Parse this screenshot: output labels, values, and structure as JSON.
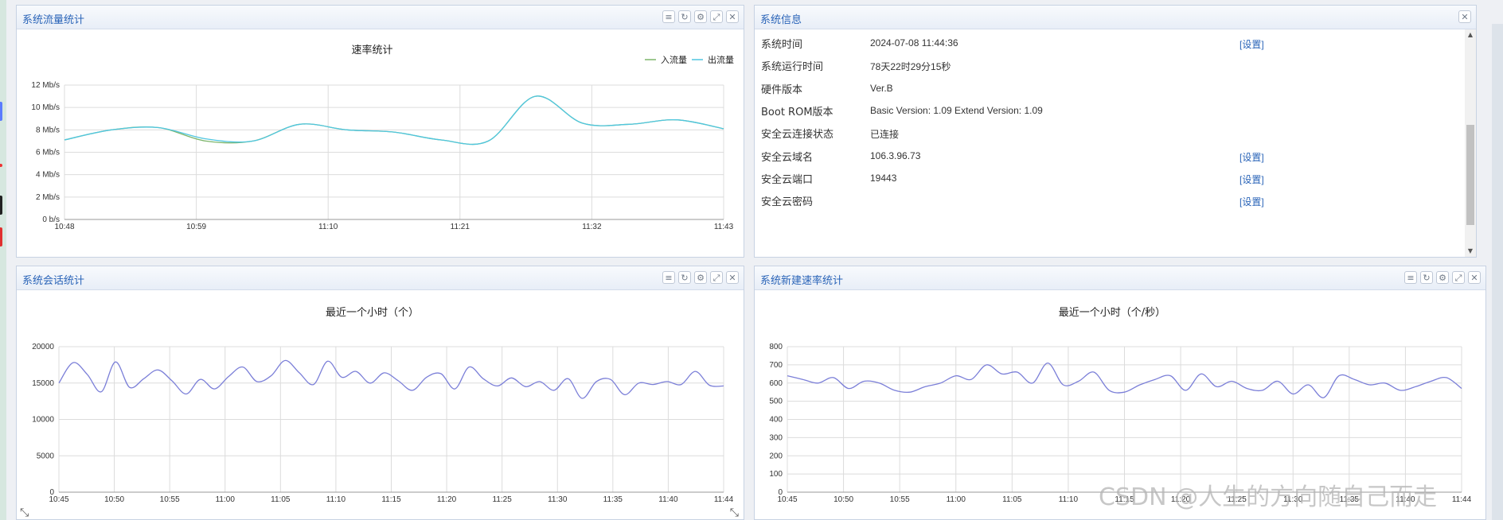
{
  "panels": {
    "traffic": {
      "title": "系统流量统计",
      "icons": [
        "list-icon",
        "refresh-icon",
        "gear-icon",
        "expand-icon",
        "close-icon"
      ]
    },
    "sysinfo": {
      "title": "系统信息",
      "icons": [
        "close-icon"
      ],
      "rows": [
        {
          "label": "系统时间",
          "value": "2024-07-08 11:44:36",
          "link": "[设置]"
        },
        {
          "label": "系统运行时间",
          "value": "78天22时29分15秒",
          "link": ""
        },
        {
          "label": "硬件版本",
          "value": "Ver.B",
          "link": ""
        },
        {
          "label": "Boot ROM版本",
          "value": "Basic Version:  1.09   Extend Version:  1.09",
          "link": ""
        },
        {
          "label": "安全云连接状态",
          "value": "已连接",
          "link": ""
        },
        {
          "label": "安全云域名",
          "value": "106.3.96.73",
          "link": "[设置]"
        },
        {
          "label": "安全云端口",
          "value": "19443",
          "link": "[设置]"
        },
        {
          "label": "安全云密码",
          "value": "",
          "link": "[设置]"
        }
      ]
    },
    "sessions": {
      "title": "系统会话统计",
      "icons": [
        "list-icon",
        "refresh-icon",
        "gear-icon",
        "expand-icon",
        "close-icon"
      ]
    },
    "newrate": {
      "title": "系统新建速率统计",
      "icons": [
        "list-icon",
        "refresh-icon",
        "gear-icon",
        "expand-icon",
        "close-icon"
      ]
    }
  },
  "watermark": "CSDN @人生的方向随自己而走",
  "chart_data": [
    {
      "type": "line",
      "title": "速率统计",
      "x": [
        "10:48",
        "10:59",
        "11:10",
        "11:21",
        "11:32",
        "11:43"
      ],
      "y_ticks": [
        "0 b/s",
        "2 Mb/s",
        "4 Mb/s",
        "6 Mb/s",
        "8 Mb/s",
        "10 Mb/s",
        "12 Mb/s"
      ],
      "ylim": [
        0,
        12
      ],
      "legend_position": "top-right",
      "series": [
        {
          "name": "入流量",
          "color": "#7cb56b",
          "values": [
            7.1,
            8.0,
            8.2,
            7.0,
            7.0,
            8.5,
            8.0,
            7.8,
            7.1,
            7.0,
            11.0,
            8.6,
            8.5,
            8.9,
            8.1
          ]
        },
        {
          "name": "出流量",
          "color": "#4fc6e0",
          "values": [
            7.1,
            8.0,
            8.2,
            7.2,
            7.0,
            8.5,
            8.0,
            7.8,
            7.1,
            7.0,
            11.0,
            8.6,
            8.5,
            8.9,
            8.1
          ]
        }
      ]
    },
    {
      "type": "line",
      "title": "最近一个小时（个）",
      "x": [
        "10:45",
        "10:50",
        "10:55",
        "11:00",
        "11:05",
        "11:10",
        "11:15",
        "11:20",
        "11:25",
        "11:30",
        "11:35",
        "11:40",
        "11:44"
      ],
      "y_ticks": [
        "0",
        "5000",
        "10000",
        "15000",
        "20000"
      ],
      "ylim": [
        0,
        20000
      ],
      "series": [
        {
          "color": "#7b7fd8",
          "values": [
            15000,
            17800,
            16200,
            13800,
            17900,
            14400,
            15600,
            16800,
            15300,
            13500,
            15500,
            14200,
            15900,
            17200,
            15200,
            16000,
            18100,
            16400,
            14800,
            18000,
            15800,
            16600,
            15000,
            16400,
            15300,
            14000,
            15800,
            16300,
            14200,
            17200,
            15600,
            14600,
            15700,
            14500,
            15200,
            14000,
            15600,
            12900,
            15200,
            15500,
            13400,
            15000,
            14800,
            15200,
            14800,
            16600,
            14700,
            14600
          ]
        }
      ]
    },
    {
      "type": "line",
      "title": "最近一个小时（个/秒）",
      "x": [
        "10:45",
        "10:50",
        "10:55",
        "11:00",
        "11:05",
        "11:10",
        "11:15",
        "11:20",
        "11:25",
        "11:30",
        "11:35",
        "11:40",
        "11:44"
      ],
      "y_ticks": [
        "0",
        "100",
        "200",
        "300",
        "400",
        "500",
        "600",
        "700",
        "800"
      ],
      "ylim": [
        0,
        800
      ],
      "series": [
        {
          "color": "#7b7fd8",
          "values": [
            640,
            620,
            600,
            630,
            570,
            610,
            600,
            560,
            550,
            580,
            600,
            640,
            620,
            700,
            650,
            660,
            600,
            710,
            590,
            610,
            660,
            560,
            550,
            590,
            620,
            640,
            560,
            650,
            580,
            610,
            570,
            560,
            610,
            540,
            590,
            520,
            640,
            620,
            590,
            600,
            560,
            580,
            610,
            630,
            570
          ]
        }
      ]
    }
  ]
}
